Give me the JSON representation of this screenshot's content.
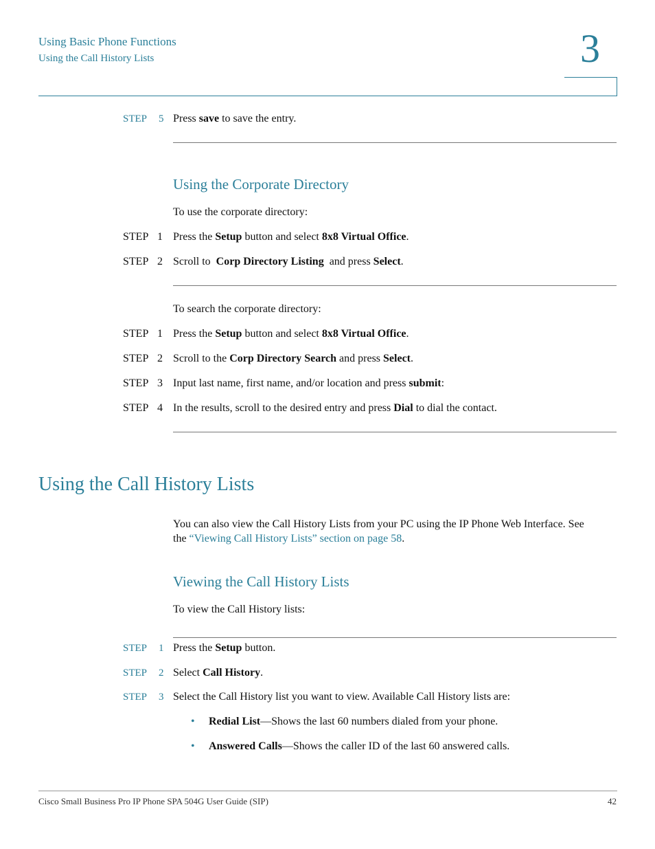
{
  "header": {
    "chapter_title": "Using Basic Phone Functions",
    "section_title": "Using the Call History Lists",
    "chapter_number": "3"
  },
  "step5_prev": {
    "label": "STEP",
    "num": "5",
    "text_a": "Press ",
    "bold_a": "save",
    "text_b": " to save the entry."
  },
  "corp_dir": {
    "heading": "Using the Corporate Directory",
    "intro": "To use the corporate directory:",
    "steps": [
      {
        "label": "STEP",
        "num": "1",
        "t1": "Press the ",
        "b1": "Setup",
        "t2": " button and select ",
        "b2": "8x8 Virtual Office",
        "t3": "."
      },
      {
        "label": "STEP",
        "num": "2",
        "t1": "Scroll to  ",
        "b1": "Corp Directory Listing",
        "t2": "  and press ",
        "b2": "Select",
        "t3": "."
      }
    ],
    "search_intro": "To search the corporate directory:",
    "search_steps": [
      {
        "label": "STEP",
        "num": "1",
        "t1": "Press the ",
        "b1": "Setup",
        "t2": " button and select ",
        "b2": "8x8 Virtual Office",
        "t3": "."
      },
      {
        "label": "STEP",
        "num": "2",
        "t1": "Scroll to the ",
        "b1": "Corp Directory Search",
        "t2": " and press ",
        "b2": "Select",
        "t3": "."
      },
      {
        "label": "STEP",
        "num": "3",
        "t1": "Input last name, first name, and/or location and press ",
        "b1": "submit",
        "t2": ":",
        "b2": "",
        "t3": ""
      },
      {
        "label": "STEP",
        "num": "4",
        "t1": "In the results, scroll to the desired entry and press ",
        "b1": "Dial",
        "t2": " to dial the contact.",
        "b2": "",
        "t3": ""
      }
    ]
  },
  "call_history": {
    "heading": "Using the Call History Lists",
    "para_line1": "You can also view the Call History Lists from your PC using the IP Phone Web Interface. See",
    "para_line2_a": "the ",
    "para_link": "“Viewing Call History Lists” section on page 58",
    "para_line2_b": ".",
    "sub_heading": "Viewing the Call History Lists",
    "intro": "To view the Call History lists:",
    "steps": [
      {
        "label": "STEP",
        "num": "1",
        "t1": "Press the ",
        "b1": "Setup",
        "t2": " button."
      },
      {
        "label": "STEP",
        "num": "2",
        "t1": "Select ",
        "b1": "Call History",
        "t2": "."
      },
      {
        "label": "STEP",
        "num": "3",
        "t1": "Select the Call History list you want to view. Available Call History lists are:",
        "b1": "",
        "t2": ""
      }
    ],
    "bullets": [
      {
        "bold": "Redial List",
        "text": "—Shows the last 60 numbers dialed from your phone."
      },
      {
        "bold": "Answered Calls",
        "text": "—Shows the caller ID of the last 60 answered calls."
      }
    ],
    "bullet_char": "•"
  },
  "footer": {
    "title": "Cisco Small Business Pro IP Phone SPA 504G User Guide (SIP)",
    "page": "42"
  }
}
